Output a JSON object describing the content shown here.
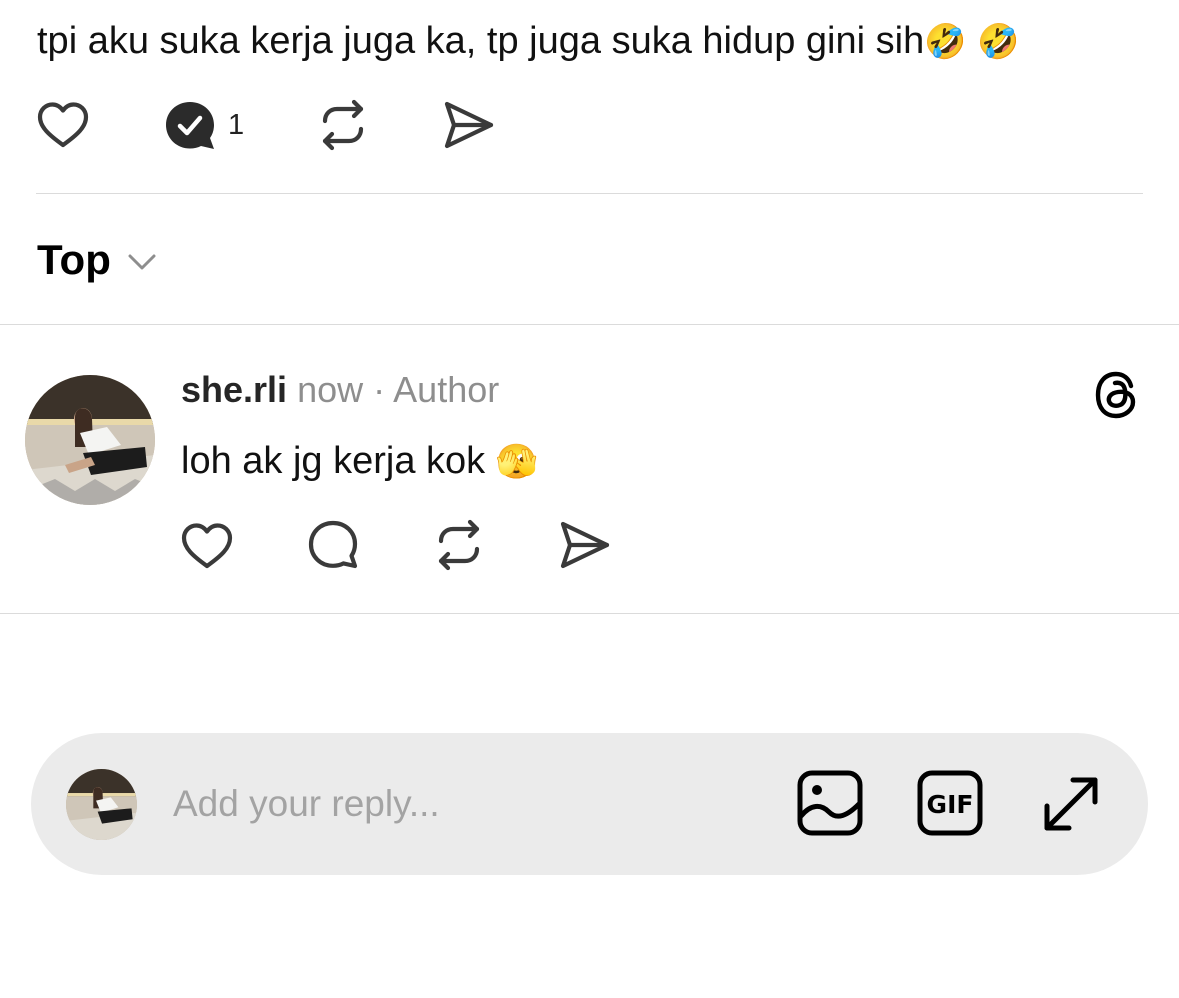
{
  "post": {
    "text": "tpi aku suka kerja juga ka, tp juga suka hidup gini sih",
    "emoji": "🤣 🤣",
    "comment_count": "1"
  },
  "sort": {
    "label": "Top"
  },
  "comment": {
    "username": "she.rli",
    "time": "now",
    "separator": "·",
    "badge": "Author",
    "text": "loh ak jg kerja kok",
    "emoji": "🫣"
  },
  "composer": {
    "placeholder": "Add your reply...",
    "gif_label": "GIF"
  },
  "icons": {
    "like": "heart-icon",
    "comment": "comment-bubble-icon",
    "comment_active": "comment-bubble-check-icon",
    "repost": "repost-icon",
    "share": "send-icon",
    "sort": "chevron-down-icon",
    "threads": "threads-logo-icon",
    "image": "image-icon",
    "gif": "gif-icon",
    "expand": "expand-icon"
  },
  "colors": {
    "text": "#000000",
    "muted": "#8e8e8e",
    "divider": "#dbdbdb",
    "composer_bg": "#ebebeb",
    "icon": "#3a3a3a"
  }
}
